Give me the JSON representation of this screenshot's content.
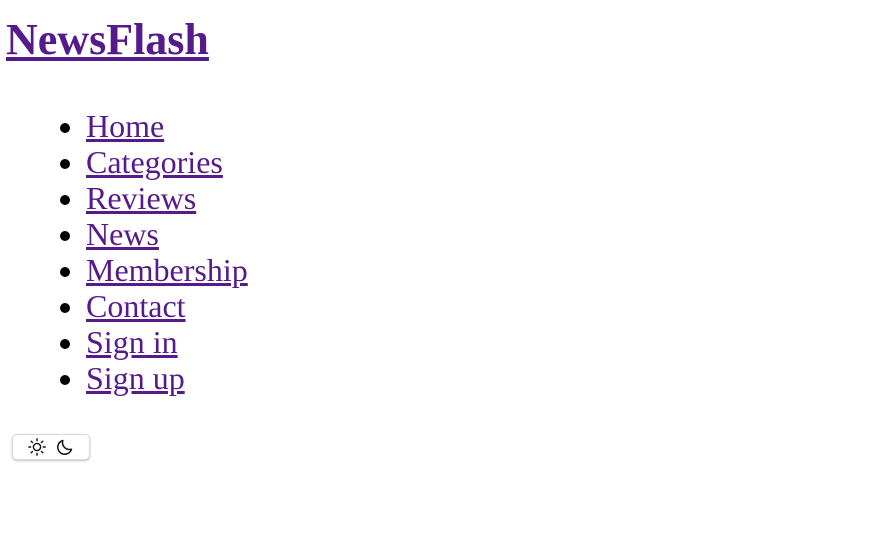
{
  "site": {
    "title": "NewsFlash"
  },
  "nav": {
    "items": [
      {
        "label": "Home"
      },
      {
        "label": "Categories"
      },
      {
        "label": "Reviews"
      },
      {
        "label": "News"
      },
      {
        "label": "Membership"
      },
      {
        "label": "Contact"
      },
      {
        "label": "Sign in"
      },
      {
        "label": "Sign up"
      }
    ]
  },
  "theme_toggle": {
    "icons": [
      "sun-icon",
      "moon-icon"
    ]
  },
  "colors": {
    "link": "#551a8b",
    "text": "#000000",
    "background": "#ffffff"
  }
}
